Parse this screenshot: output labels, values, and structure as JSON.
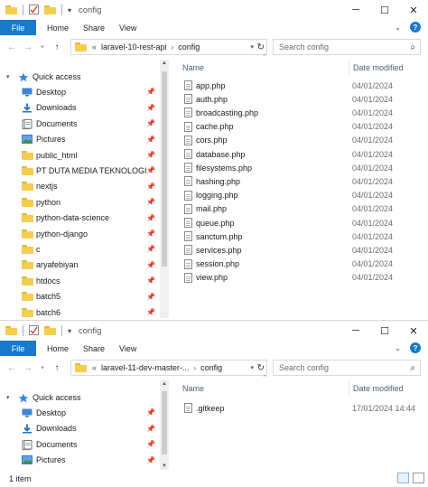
{
  "colors": {
    "accent": "#1979ca",
    "folder": "#f4cd52",
    "header_text": "#4c607a",
    "date_text": "#6d6d6d"
  },
  "window1": {
    "title": "config",
    "ribbon": {
      "file": "File",
      "tabs": [
        "Home",
        "Share",
        "View"
      ]
    },
    "address": {
      "overflow": "«",
      "crumbs": [
        "laravel-10-rest-api",
        "config"
      ]
    },
    "search_placeholder": "Search config",
    "sidebar": [
      {
        "label": "Quick access",
        "icon": "star-icon",
        "pinned": false,
        "header": true
      },
      {
        "label": "Desktop",
        "icon": "desktop-icon",
        "pinned": true
      },
      {
        "label": "Downloads",
        "icon": "download-icon",
        "pinned": true
      },
      {
        "label": "Documents",
        "icon": "documents-icon",
        "pinned": true
      },
      {
        "label": "Pictures",
        "icon": "pictures-icon",
        "pinned": true
      },
      {
        "label": "public_html",
        "icon": "folder-icon",
        "pinned": true
      },
      {
        "label": "PT DUTA MEDIA TEKNOLOGI",
        "icon": "folder-icon",
        "pinned": true
      },
      {
        "label": "nextjs",
        "icon": "folder-icon",
        "pinned": true
      },
      {
        "label": "python",
        "icon": "folder-icon",
        "pinned": true
      },
      {
        "label": "python-data-science",
        "icon": "folder-icon",
        "pinned": true
      },
      {
        "label": "python-django",
        "icon": "folder-icon",
        "pinned": true
      },
      {
        "label": "c",
        "icon": "folder-icon",
        "pinned": true
      },
      {
        "label": "aryafebiyan",
        "icon": "folder-icon",
        "pinned": true
      },
      {
        "label": "htdocs",
        "icon": "folder-icon",
        "pinned": true
      },
      {
        "label": "batch5",
        "icon": "folder-icon",
        "pinned": true
      },
      {
        "label": "batch6",
        "icon": "folder-icon",
        "pinned": true
      }
    ],
    "columns": {
      "name": "Name",
      "date": "Date modified"
    },
    "files": [
      {
        "name": "app.php",
        "date": "04/01/2024 "
      },
      {
        "name": "auth.php",
        "date": "04/01/2024 "
      },
      {
        "name": "broadcasting.php",
        "date": "04/01/2024 "
      },
      {
        "name": "cache.php",
        "date": "04/01/2024 "
      },
      {
        "name": "cors.php",
        "date": "04/01/2024 "
      },
      {
        "name": "database.php",
        "date": "04/01/2024 "
      },
      {
        "name": "filesystems.php",
        "date": "04/01/2024 "
      },
      {
        "name": "hashing.php",
        "date": "04/01/2024 "
      },
      {
        "name": "logging.php",
        "date": "04/01/2024 "
      },
      {
        "name": "mail.php",
        "date": "04/01/2024 "
      },
      {
        "name": "queue.php",
        "date": "04/01/2024 "
      },
      {
        "name": "sanctum.php",
        "date": "04/01/2024 "
      },
      {
        "name": "services.php",
        "date": "04/01/2024 "
      },
      {
        "name": "session.php",
        "date": "04/01/2024 "
      },
      {
        "name": "view.php",
        "date": "04/01/2024 "
      }
    ]
  },
  "window2": {
    "title": "config",
    "ribbon": {
      "file": "File",
      "tabs": [
        "Home",
        "Share",
        "View"
      ]
    },
    "address": {
      "overflow": "«",
      "crumbs": [
        "laravel-11-dev-master-...",
        "config"
      ]
    },
    "search_placeholder": "Search config",
    "sidebar": [
      {
        "label": "Quick access",
        "icon": "star-icon",
        "pinned": false,
        "header": true
      },
      {
        "label": "Desktop",
        "icon": "desktop-icon",
        "pinned": true
      },
      {
        "label": "Downloads",
        "icon": "download-icon",
        "pinned": true
      },
      {
        "label": "Documents",
        "icon": "documents-icon",
        "pinned": true
      },
      {
        "label": "Pictures",
        "icon": "pictures-icon",
        "pinned": true
      }
    ],
    "columns": {
      "name": "Name",
      "date": "Date modified"
    },
    "files": [
      {
        "name": ".gitkeep",
        "date": "17/01/2024 14:44"
      }
    ],
    "status": "1 item"
  }
}
